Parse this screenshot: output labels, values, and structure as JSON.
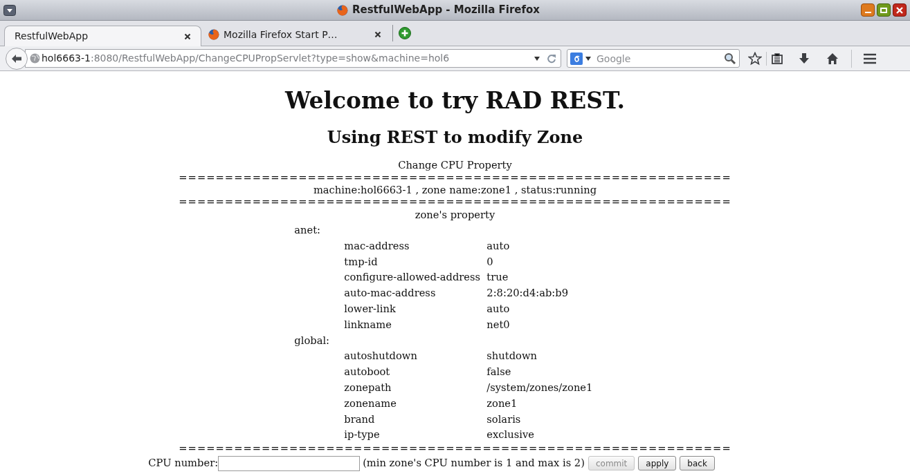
{
  "window": {
    "title": "RestfulWebApp - Mozilla Firefox"
  },
  "tabs": [
    {
      "label": "RestfulWebApp",
      "selected": true,
      "favicon": false
    },
    {
      "label": "Mozilla Firefox Start P…",
      "selected": false,
      "favicon": true
    }
  ],
  "address_bar": {
    "host": "hol6663-1",
    "rest": ":8080/RestfulWebApp/ChangeCPUPropServlet?type=show&machine=hol6"
  },
  "search": {
    "placeholder": "Google"
  },
  "page": {
    "heading": "Welcome to try RAD REST.",
    "subheading": "Using REST to modify Zone",
    "title": "Change CPU Property",
    "separator": "============================================================",
    "info": "machine:hol6663-1 , zone name:zone1 , status:running",
    "section": "zone's property",
    "groups": [
      {
        "name": "anet:",
        "properties": [
          {
            "key": "mac-address",
            "value": "auto"
          },
          {
            "key": "tmp-id",
            "value": "0"
          },
          {
            "key": "configure-allowed-address",
            "value": "true"
          },
          {
            "key": "auto-mac-address",
            "value": "2:8:20:d4:ab:b9"
          },
          {
            "key": "lower-link",
            "value": "auto"
          },
          {
            "key": "linkname",
            "value": "net0"
          }
        ]
      },
      {
        "name": "global:",
        "properties": [
          {
            "key": "autoshutdown",
            "value": "shutdown"
          },
          {
            "key": "autoboot",
            "value": "false"
          },
          {
            "key": "zonepath",
            "value": "/system/zones/zone1"
          },
          {
            "key": "zonename",
            "value": "zone1"
          },
          {
            "key": "brand",
            "value": "solaris"
          },
          {
            "key": "ip-type",
            "value": "exclusive"
          }
        ]
      }
    ],
    "form": {
      "label": "CPU number:",
      "hint": "(min zone's CPU number is 1 and max is 2)",
      "buttons": [
        {
          "label": "commit",
          "disabled": true
        },
        {
          "label": "apply",
          "disabled": false
        },
        {
          "label": "back",
          "disabled": false
        }
      ]
    }
  }
}
